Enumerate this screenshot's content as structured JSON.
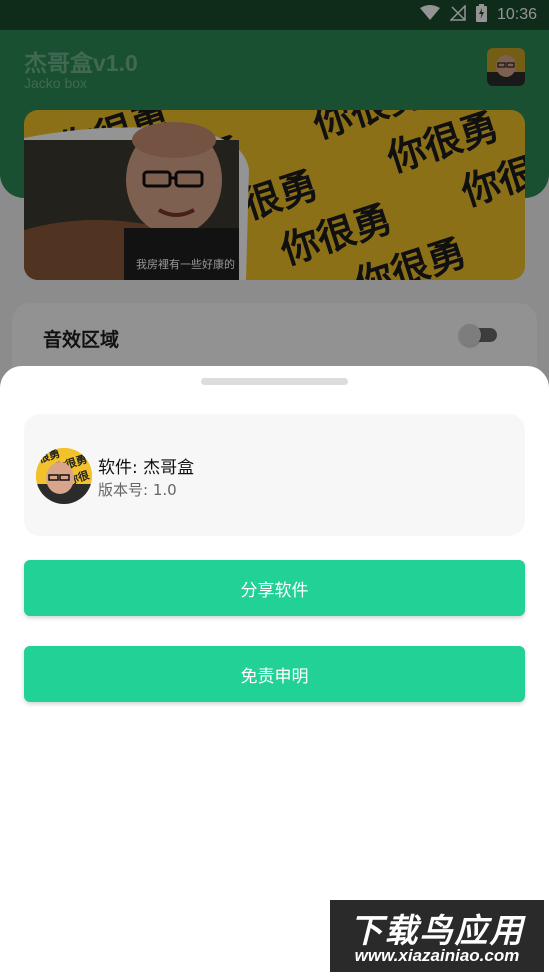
{
  "status_bar": {
    "time": "10:36"
  },
  "header": {
    "title": "杰哥盒v1.0",
    "subtitle": "Jacko box"
  },
  "banner": {
    "tile_text": "你很勇",
    "caption": "我房裡有一些好康的"
  },
  "sound_section": {
    "title": "音效区域",
    "toggle_on": false
  },
  "sheet": {
    "software_name": "软件: 杰哥盒",
    "version": "版本号: 1.0",
    "share_label": "分享软件",
    "disclaimer_label": "免责申明"
  },
  "watermark": {
    "title": "下载鸟应用",
    "url": "www.xiazainiao.com"
  },
  "colors": {
    "accent": "#22d196",
    "header": "#2c8b57",
    "banner_yellow": "#f1c22a"
  },
  "icons": [
    "wifi-icon",
    "signal-icon",
    "battery-icon"
  ]
}
